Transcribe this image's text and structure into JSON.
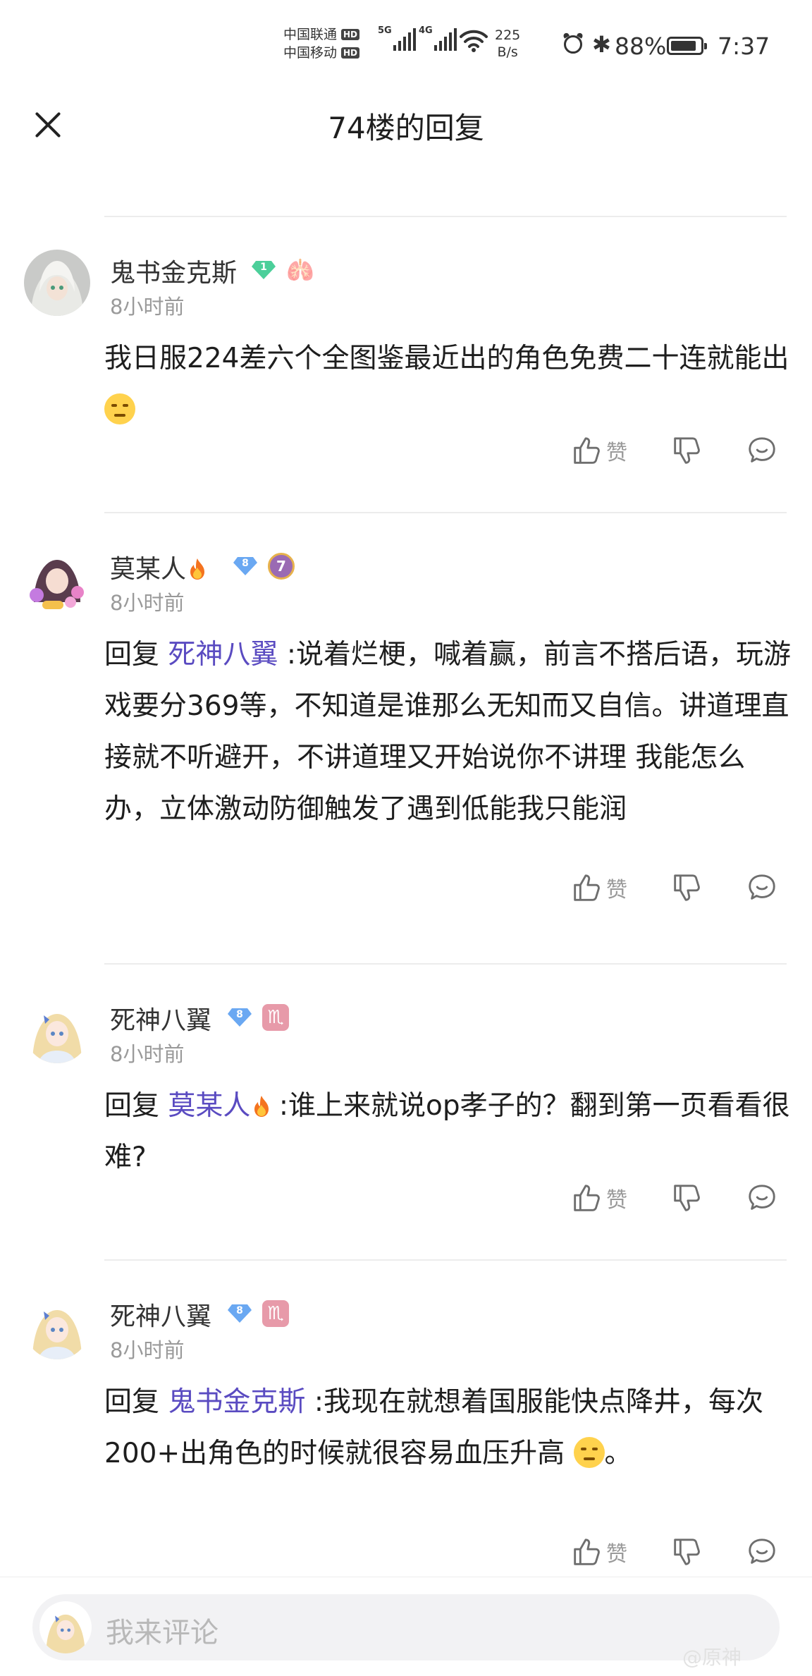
{
  "status_bar": {
    "carrier_1": "中国联通",
    "carrier_2": "中国移动",
    "hd": "HD",
    "network_1": "5G",
    "network_2": "4G",
    "speed_value": "225",
    "speed_unit": "B/s",
    "bluetooth_glyph": "✱",
    "battery_percent": "88%",
    "battery_level": 0.88,
    "time": "7:37",
    "icons": [
      "signal-icon",
      "wifi-icon",
      "alarm-icon",
      "bluetooth-icon",
      "battery-icon"
    ]
  },
  "nav": {
    "title": "74楼的回复",
    "close_icon": "close-icon"
  },
  "actions": {
    "like_label": "赞",
    "icons": [
      "thumbs-up-icon",
      "thumbs-down-icon",
      "comment-icon"
    ]
  },
  "replies": [
    {
      "username": "鬼书金克斯",
      "level": "1",
      "level_color": "#4ccf9a",
      "extra_badge": "lungs",
      "time": "8小时前",
      "text": "我日服224差六个全图鉴最近出的角色免费二十连就能出",
      "trailing_emoji": "thinking-face"
    },
    {
      "username": "莫某人",
      "level": "8",
      "level_color": "#6aa8f2",
      "medal": "7",
      "time": "8小时前",
      "reply_prefix": "回复",
      "mention": "死神八翼",
      "text": ":说着烂梗，喊着赢，前言不搭后语，玩游戏要分369等，不知道是谁那么无知而又自信。讲道理直接就不听避开，不讲道理又开始说你不讲理 我能怎么办，立体激动防御触发了遇到低能我只能润"
    },
    {
      "username": "死神八翼",
      "level": "8",
      "level_color": "#6aa8f2",
      "sign": "♏",
      "time": "8小时前",
      "reply_prefix": "回复",
      "mention": "莫某人",
      "text": ":谁上来就说op孝子的？翻到第一页看看很难?"
    },
    {
      "username": "死神八翼",
      "level": "8",
      "level_color": "#6aa8f2",
      "sign": "♏",
      "time": "8小时前",
      "reply_prefix": "回复",
      "mention": "鬼书金克斯",
      "text": ":我现在就想着国服能快点降井，每次200+出角色的时候就很容易血压升高",
      "trailing_emoji": "unamused-face",
      "trailing_text": "。"
    }
  ],
  "comment_bar": {
    "placeholder": "我来评论",
    "watermark": "@原神"
  }
}
